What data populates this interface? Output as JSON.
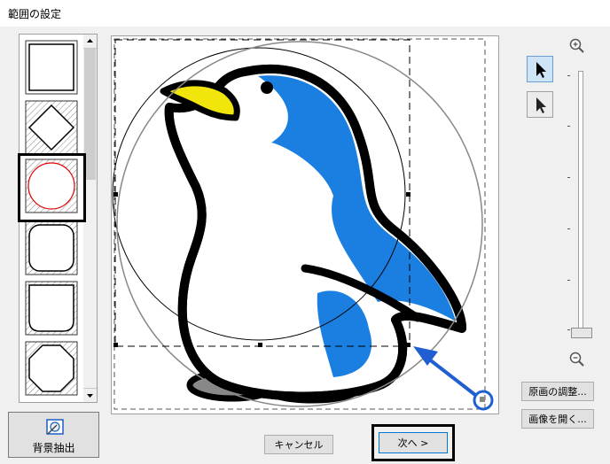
{
  "window": {
    "title": "範囲の設定"
  },
  "shapes": [
    {
      "name": "square"
    },
    {
      "name": "diamond"
    },
    {
      "name": "circle",
      "selected": true
    },
    {
      "name": "rounded-rect"
    },
    {
      "name": "chamfered-rect"
    },
    {
      "name": "octagon"
    }
  ],
  "tools": [
    {
      "icon": "select-arrow-icon",
      "active": true
    },
    {
      "icon": "direct-select-arrow-icon",
      "active": false
    }
  ],
  "zoom": {
    "in_icon": "zoom-in-icon",
    "out_icon": "zoom-out-icon"
  },
  "buttons": {
    "adjust_original": "原画の調整...",
    "open_image": "画像を開く...",
    "extract_background": "背景抽出",
    "cancel": "キャンセル",
    "next": "次へ >"
  },
  "colors": {
    "penguin_blue": "#1a7fe0",
    "beak_yellow": "#f2e50b",
    "annotation_blue": "#1f5fd1"
  }
}
